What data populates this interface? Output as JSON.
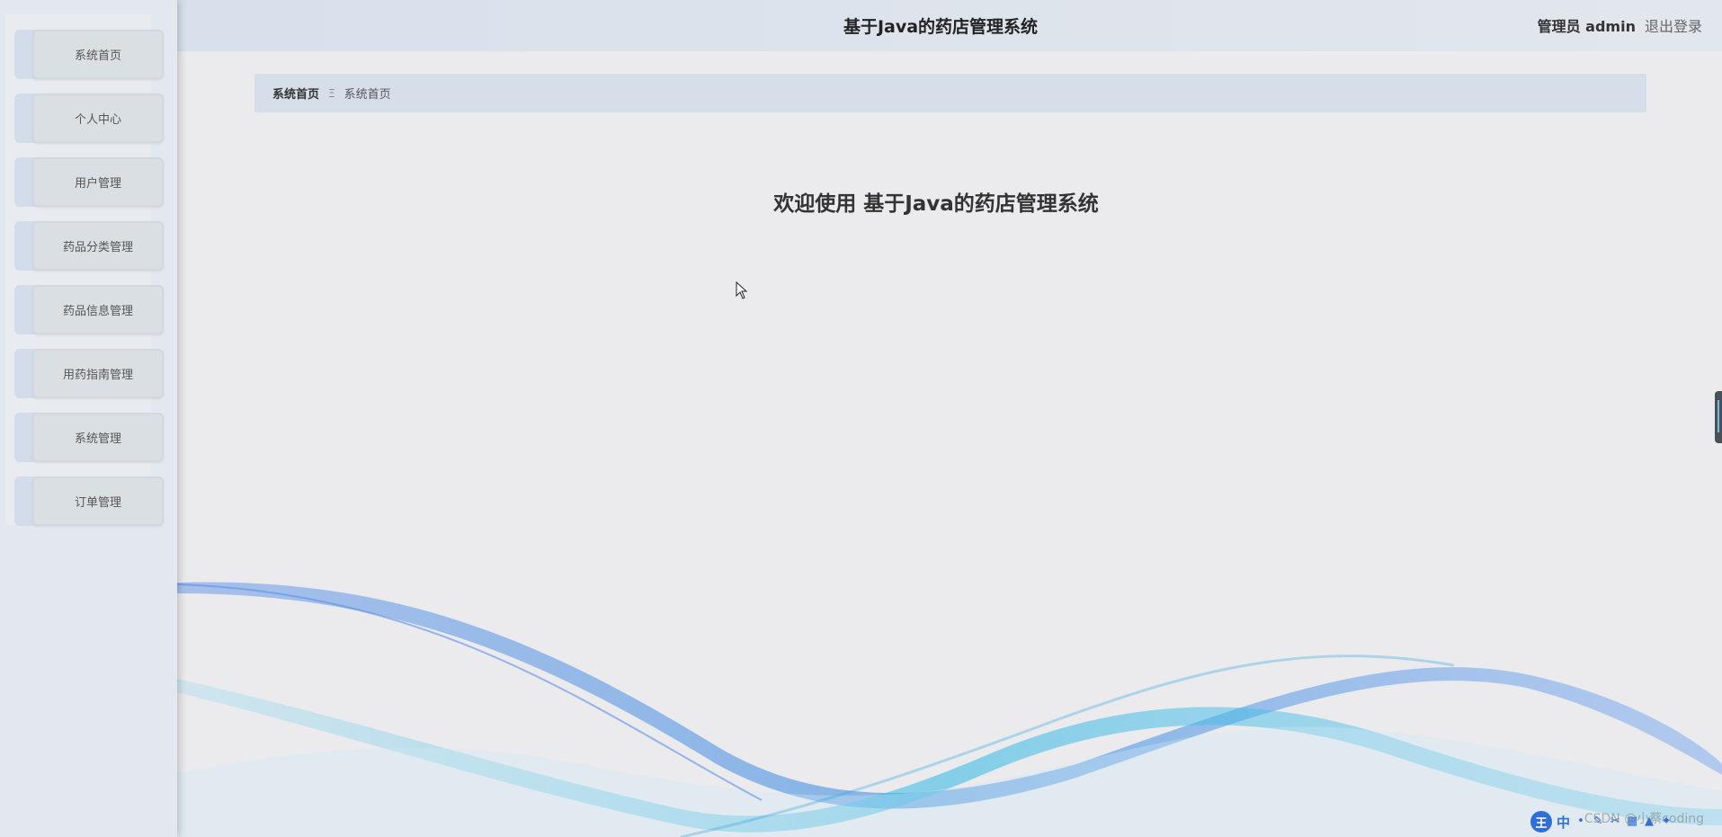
{
  "header": {
    "title": "基于Java的药店管理系统",
    "user_label": "管理员 admin",
    "logout_label": "退出登录"
  },
  "sidebar": {
    "items": [
      {
        "label": "系统首页"
      },
      {
        "label": "个人中心"
      },
      {
        "label": "用户管理"
      },
      {
        "label": "药品分类管理"
      },
      {
        "label": "药品信息管理"
      },
      {
        "label": "用药指南管理"
      },
      {
        "label": "系统管理"
      },
      {
        "label": "订单管理"
      }
    ]
  },
  "breadcrumb": {
    "root": "系统首页",
    "separator": "Ξ",
    "current": "系统首页"
  },
  "main": {
    "welcome": "欢迎使用 基于Java的药店管理系统"
  },
  "ime": {
    "logo": "王",
    "mode": "中"
  },
  "watermark": "CSDN @小蔡coding",
  "colors": {
    "accent": "#2f6fd6",
    "header_bg": "#d8e0ec",
    "breadcrumb_bg": "#d6dee9",
    "sidebar_bg": "#e3e7ef"
  }
}
